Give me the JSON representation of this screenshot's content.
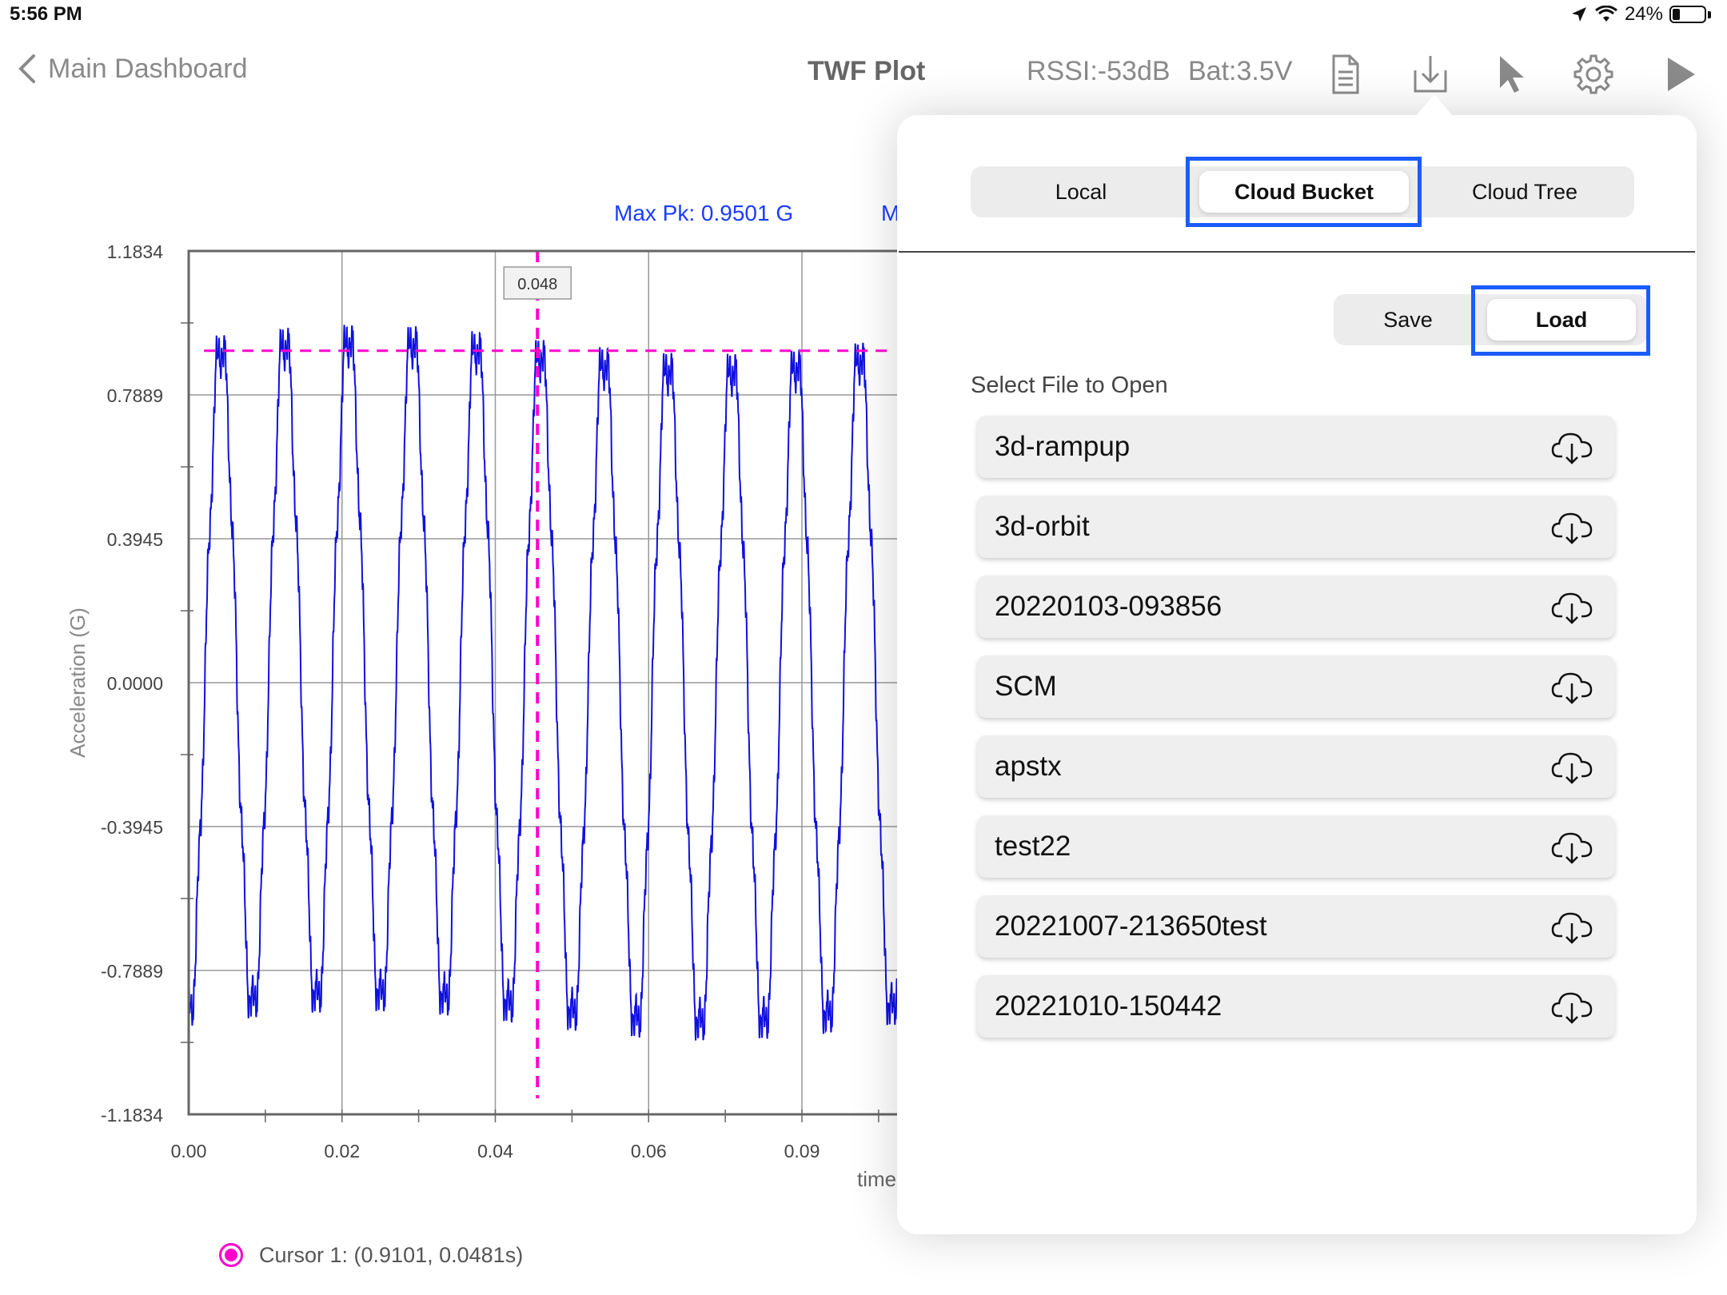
{
  "status_bar": {
    "time": "5:56 PM",
    "battery_pct": "24%",
    "battery_level": 0.24
  },
  "nav": {
    "back_label": "Main Dashboard",
    "title": "TWF Plot",
    "rssi": "RSSI:-53dB",
    "bat": "Bat:3.5V"
  },
  "toolbar_icons": [
    "document-icon",
    "download-icon",
    "pointer-icon",
    "gear-icon",
    "play-icon"
  ],
  "chart_data": {
    "type": "line",
    "title": "",
    "xlabel": "time",
    "ylabel": "Acceleration (G)",
    "ylim": [
      -1.1834,
      1.1834
    ],
    "xlim": [
      0,
      0.0925
    ],
    "y_ticks": [
      "1.1834",
      "0.7889",
      "0.3945",
      "0.0000",
      "-0.3945",
      "-0.7889",
      "-1.1834"
    ],
    "x_ticks": [
      "0.00",
      "0.02",
      "0.04",
      "0.06",
      "0.09"
    ],
    "x_tick_values": [
      0,
      0.02,
      0.04,
      0.06,
      0.08
    ],
    "max_pk_label": "Max Pk: 0.9501 G",
    "max_pk_value": 0.9101,
    "second_label_visible": "M",
    "series": [
      {
        "values_description": "",
        "frequency_hz": 120,
        "amplitude": 0.92,
        "color": "#1010e0"
      }
    ],
    "cursor": {
      "x": 0.0455,
      "label": "0.048",
      "color": "#ff00cc"
    },
    "legend": "Cursor 1: (0.9101, 0.0481s)"
  },
  "popover": {
    "tabs": [
      {
        "label": "Local",
        "selected": false
      },
      {
        "label": "Cloud Bucket",
        "selected": true
      },
      {
        "label": "Cloud Tree",
        "selected": false
      }
    ],
    "save_label": "Save",
    "load_label": "Load",
    "select_label": "Select File to Open",
    "files": [
      "3d-rampup",
      "3d-orbit",
      "20220103-093856",
      "SCM",
      "apstx",
      "test22",
      "20221007-213650test",
      "20221010-150442"
    ]
  },
  "colors": {
    "accent": "#1a5cff",
    "trace": "#1010e0",
    "cursor": "#ff00cc"
  }
}
